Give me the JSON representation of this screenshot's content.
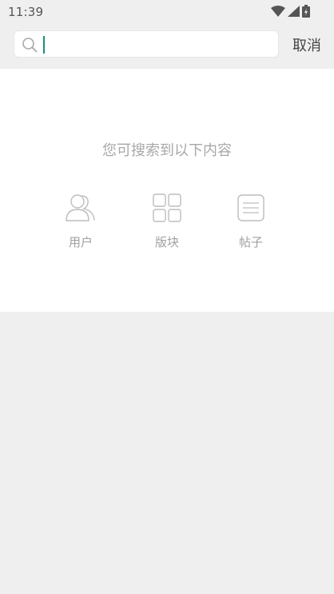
{
  "status_bar": {
    "time": "11:39",
    "icons": [
      "wifi-icon",
      "signal-icon",
      "battery-icon"
    ]
  },
  "search": {
    "value": "",
    "placeholder": "",
    "cancel_label": "取消"
  },
  "content": {
    "hint": "您可搜索到以下内容",
    "categories": [
      {
        "label": "用户",
        "icon": "user-icon"
      },
      {
        "label": "版块",
        "icon": "grid-icon"
      },
      {
        "label": "帖子",
        "icon": "post-icon"
      }
    ]
  },
  "colors": {
    "background": "#efefef",
    "card": "#ffffff",
    "cursor": "#1f8f7a",
    "hint_text": "#a8a8a8",
    "icon_stroke": "#bdbdbd"
  }
}
